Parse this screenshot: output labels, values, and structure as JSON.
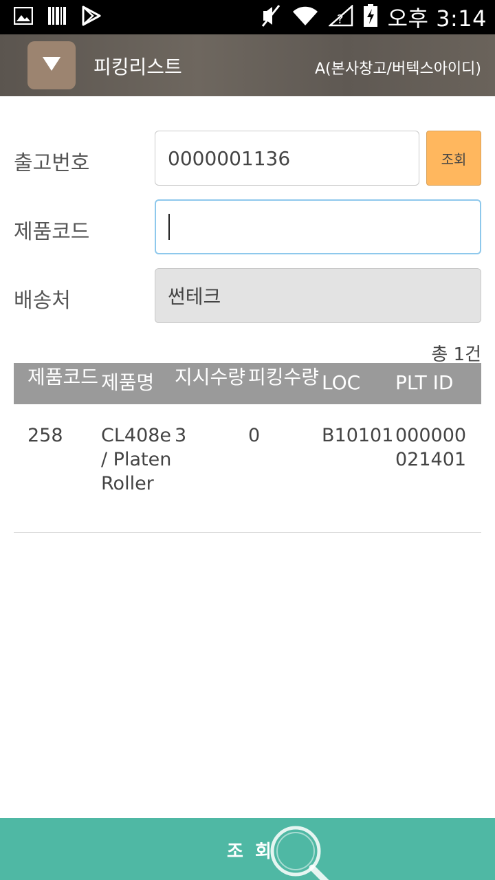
{
  "status_bar": {
    "time": "오후 3:14",
    "icons": [
      "image-icon",
      "barcode-icon",
      "play-store-icon",
      "mute-icon",
      "wifi-icon",
      "no-signal-icon",
      "battery-charging-icon"
    ]
  },
  "header": {
    "title": "피킹리스트",
    "subtitle": "A(본사창고/버텍스아이디)",
    "menu_icon": "triangle-down-icon"
  },
  "form": {
    "shipment_no": {
      "label": "출고번호",
      "value": "0000001136",
      "button": "조회"
    },
    "product_code": {
      "label": "제품코드",
      "value": ""
    },
    "destination": {
      "label": "배송처",
      "value": "썬테크"
    }
  },
  "total": "총 1건",
  "table": {
    "columns": [
      "제품코드",
      "제품명",
      "지시수량",
      "피킹수량",
      "LOC",
      "PLT ID"
    ],
    "rows": [
      [
        "258",
        "CL408e / PlatenRoller",
        "3",
        "0",
        "B10101",
        "000000021401"
      ]
    ]
  },
  "bottom_button": {
    "label": "조 회",
    "icon": "magnifier-icon"
  },
  "colors": {
    "header_bg": "#6a635b",
    "menu_button": "#9c8470",
    "lookup_button": "#ffb75e",
    "table_header": "#9a9a9a",
    "bottom_bar": "#4fb8a4",
    "focus_border": "#8ec8ec"
  }
}
